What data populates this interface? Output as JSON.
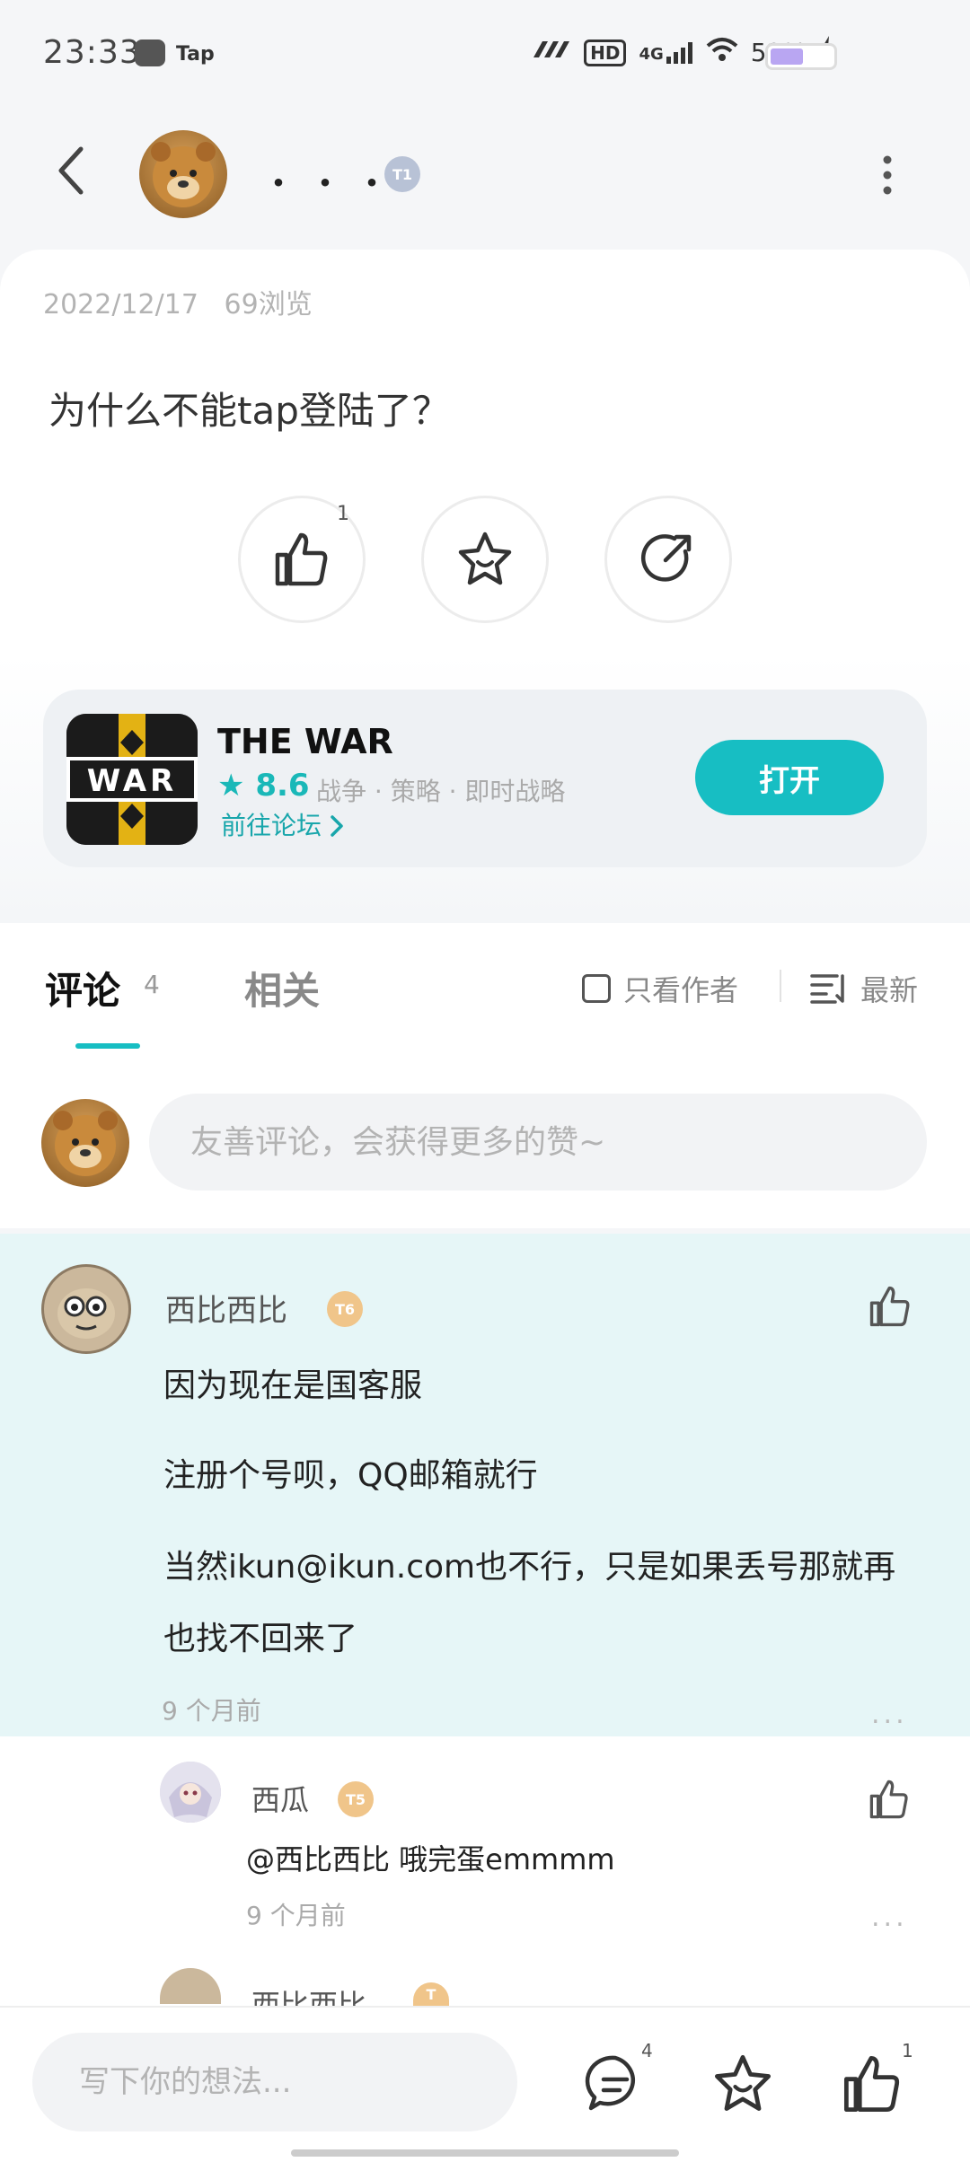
{
  "status_bar": {
    "time": "23:33",
    "app_label": "Tap",
    "network_label": "4G",
    "hd_label": "HD",
    "battery": "52%"
  },
  "header": {
    "name": "・・・",
    "level": "T1"
  },
  "post": {
    "date": "2022/12/17",
    "views": "69浏览",
    "title": "为什么不能tap登陆了？",
    "like_count": "1"
  },
  "app": {
    "name": "THE WAR",
    "rating": "8.6",
    "tags": "战争 · 策略 · 即时战略",
    "forum_link": "前往论坛",
    "open_label": "打开",
    "icon_text": "WAR"
  },
  "tabs": {
    "comments_label": "评论",
    "comments_count": "4",
    "related_label": "相关",
    "author_only_label": "只看作者",
    "sort_label": "最新"
  },
  "comment_input": {
    "placeholder": "友善评论，会获得更多的赞~"
  },
  "comments": [
    {
      "author": "西比西比",
      "level": "T6",
      "lines": [
        "因为现在是国客服",
        "注册个号呗，QQ邮箱就行",
        "当然ikun@ikun.com也不行，只是如果丢号那就再",
        "也找不回来了"
      ],
      "time": "9 个月前",
      "more": "..."
    }
  ],
  "replies": [
    {
      "author": "西瓜",
      "level": "T5",
      "text": "@西比西比  哦完蛋emmmm",
      "time": "9 个月前",
      "more": "..."
    },
    {
      "author": "西比西比",
      "level": "T"
    }
  ],
  "bottom_bar": {
    "placeholder": "写下你的想法...",
    "comment_count": "4",
    "like_count": "1"
  },
  "colors": {
    "accent": "#17bec3",
    "highlight_bg": "#e6f6f7",
    "badge_gold": "#f0c58a"
  }
}
